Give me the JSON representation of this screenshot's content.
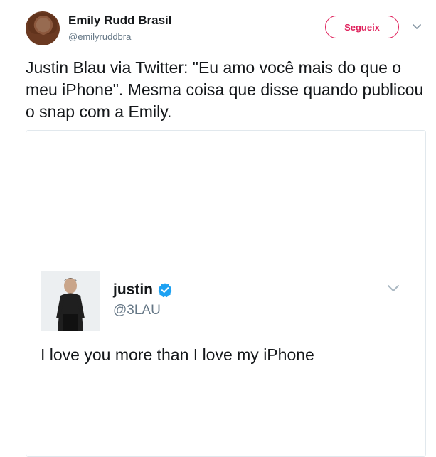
{
  "tweet": {
    "author": {
      "display_name": "Emily Rudd Brasil",
      "handle": "@emilyruddbra",
      "avatar_icon": "profile-photo"
    },
    "follow_label": "Segueix",
    "caret_icon": "chevron-down-icon",
    "text": "Justin Blau via Twitter: \"Eu amo você mais do que o meu iPhone\". Mesma coisa que disse quando publicou o snap com a Emily.",
    "colors": {
      "follow_accent": "#e0245e",
      "verified": "#1da1f2",
      "secondary_text": "#657786"
    }
  },
  "embedded_tweet": {
    "display_name": "justin",
    "verified_icon": "verified-badge-icon",
    "handle": "@3LAU",
    "text": "I love you more than I love my iPhone",
    "caret_icon": "chevron-down-icon"
  }
}
